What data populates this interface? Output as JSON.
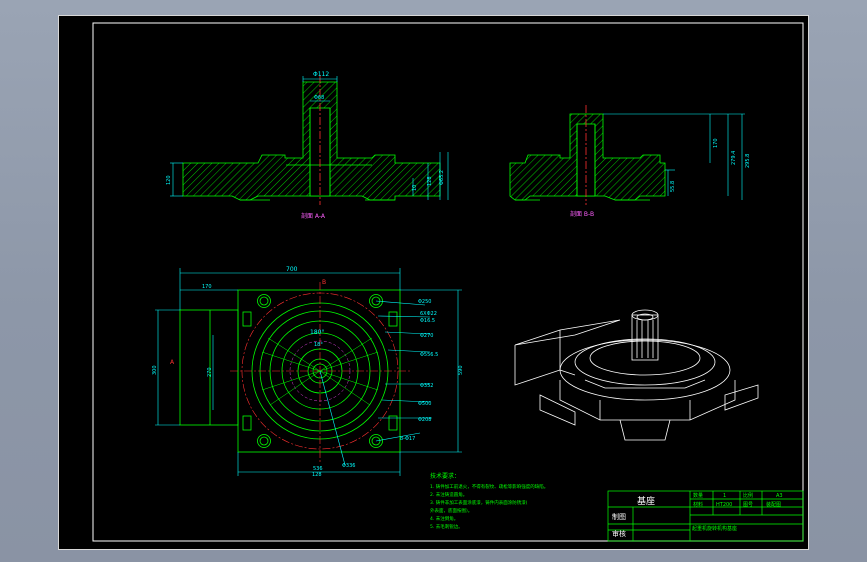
{
  "colors": {
    "background": "#8f99aa",
    "sheet": "#000000",
    "outline": "#00ff00",
    "hatch": "#00c800",
    "dimension": "#00ffff",
    "center": "#ff3030",
    "hidden": "#e040e0",
    "text": "#ffffff"
  },
  "section_a": {
    "label": "剖面 A-A",
    "dims": [
      "Φ112",
      "Φ68",
      "Φ65.2",
      "120",
      "10",
      "128"
    ]
  },
  "section_b": {
    "label": "剖面 B-B",
    "dims": [
      "170",
      "279.4",
      "295.8",
      "55.8"
    ]
  },
  "plan_view": {
    "dims": [
      "700",
      "170",
      "B",
      "A",
      "300",
      "270",
      "128",
      "180°",
      "18°",
      "590",
      "536",
      "Φ250",
      "6XΦ22",
      "Φ16.5",
      "Φ270",
      "Φ556.5",
      "Φ352",
      "Φ500",
      "Φ208",
      "8-Φ17",
      "Φ336"
    ]
  },
  "notes": {
    "title": "技术要求：",
    "lines": [
      "1. 铸件加工前退火，不得有裂纹、疏松等影响强度的缺陷。",
      "2. 未注铸造圆角。",
      "3. 铸件非加工表面涂底漆，铸件内表面涂防锈漆(",
      "   外表面，底面按图)。",
      "4. 未注倒角。",
      "5. 去毛刺锐边。"
    ]
  },
  "title_block": {
    "name": "基座",
    "company": "起重机旋转机构基座",
    "cells": [
      "数量",
      "1",
      "比例",
      "A3",
      "材料",
      "HT200",
      "图号",
      "装配图"
    ],
    "left_cells": [
      "制图",
      "审核"
    ]
  }
}
